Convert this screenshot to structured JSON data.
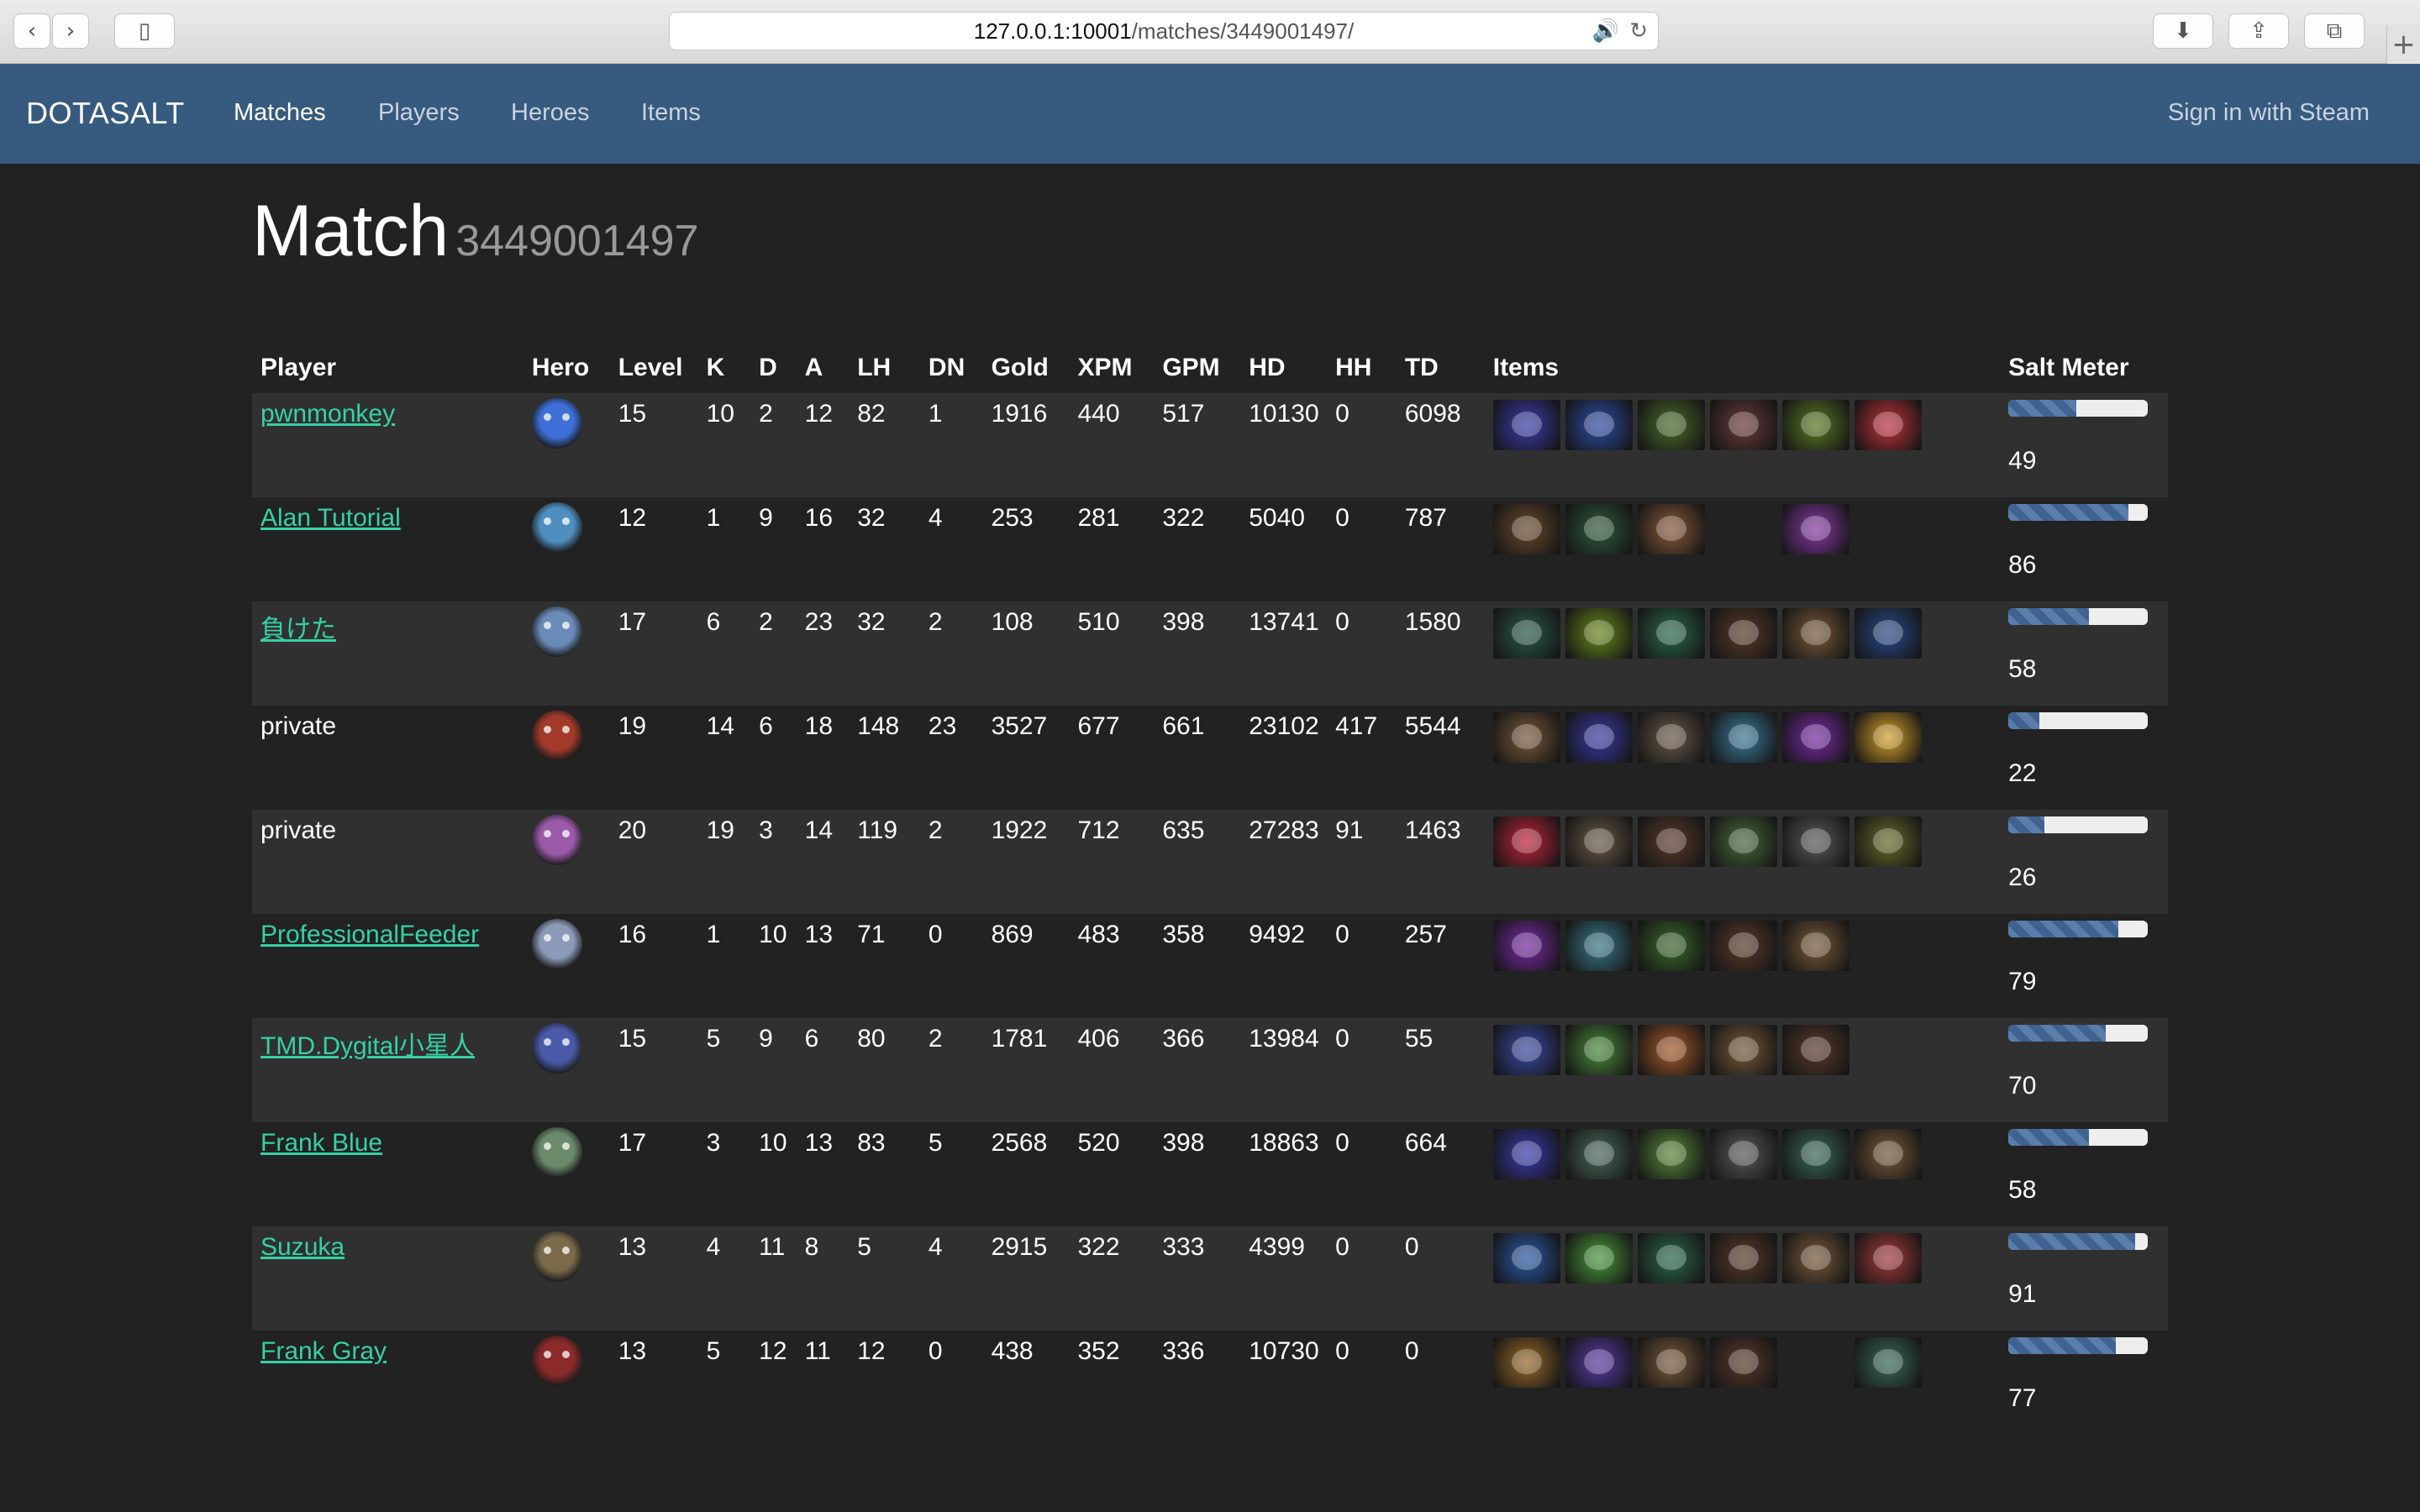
{
  "browser": {
    "url_host": "127.0.0.1:10001",
    "url_path": "/matches/3449001497/"
  },
  "nav": {
    "brand": "DOTASALT",
    "links": [
      "Matches",
      "Players",
      "Heroes",
      "Items"
    ],
    "signin": "Sign in with Steam"
  },
  "page": {
    "title": "Match",
    "match_id": "3449001497"
  },
  "table": {
    "headers": [
      "Player",
      "Hero",
      "Level",
      "K",
      "D",
      "A",
      "LH",
      "DN",
      "Gold",
      "XPM",
      "GPM",
      "HD",
      "HH",
      "TD",
      "Items",
      "Salt Meter"
    ],
    "rows": [
      {
        "player": "pwnmonkey",
        "link": true,
        "hero_color": "#3d6fd6",
        "level": "15",
        "k": "10",
        "d": "2",
        "a": "12",
        "lh": "82",
        "dn": "1",
        "gold": "1916",
        "xpm": "440",
        "gpm": "517",
        "hd": "10130",
        "hh": "0",
        "td": "6098",
        "items": [
          "#3c3cb0",
          "#2d4ea8",
          "#4a6b2a",
          "#6b3a3a",
          "#5a7a24",
          "#c2333c"
        ],
        "salt": "49",
        "salt_fraction": 0.49
      },
      {
        "player": "Alan Tutorial",
        "link": true,
        "hero_color": "#4f8fc0",
        "level": "12",
        "k": "1",
        "d": "9",
        "a": "16",
        "lh": "32",
        "dn": "4",
        "gold": "253",
        "xpm": "281",
        "gpm": "322",
        "hd": "5040",
        "hh": "0",
        "td": "787",
        "items": [
          "#6a4a2c",
          "#2e5c3c",
          "#8a5a3a",
          "",
          "#8a3aa8",
          ""
        ],
        "salt": "86",
        "salt_fraction": 0.86
      },
      {
        "player": "負けた",
        "link": true,
        "hero_color": "#6a8ab8",
        "level": "17",
        "k": "6",
        "d": "2",
        "a": "23",
        "lh": "32",
        "dn": "2",
        "gold": "108",
        "xpm": "510",
        "gpm": "398",
        "hd": "13741",
        "hh": "0",
        "td": "1580",
        "items": [
          "#2a5a4a",
          "#6a8a1a",
          "#2a6a4a",
          "#5a3a2a",
          "#7a5a3a",
          "#2a4a8a"
        ],
        "salt": "58",
        "salt_fraction": 0.58
      },
      {
        "player": "private",
        "link": false,
        "hero_color": "#a23a2a",
        "level": "19",
        "k": "14",
        "d": "6",
        "a": "18",
        "lh": "148",
        "dn": "23",
        "gold": "3527",
        "xpm": "677",
        "gpm": "661",
        "hd": "23102",
        "hh": "417",
        "td": "5544",
        "items": [
          "#7a5a3a",
          "#3a3aa8",
          "#6a5a4a",
          "#3a7a9a",
          "#7a2aa8",
          "#d8a02a"
        ],
        "salt": "22",
        "salt_fraction": 0.22
      },
      {
        "player": "private",
        "link": false,
        "hero_color": "#9a5aa8",
        "level": "20",
        "k": "19",
        "d": "3",
        "a": "14",
        "lh": "119",
        "dn": "2",
        "gold": "1922",
        "xpm": "712",
        "gpm": "635",
        "hd": "27283",
        "hh": "91",
        "td": "1463",
        "items": [
          "#c2233a",
          "#6a5a4a",
          "#5a3a2a",
          "#4a6a3a",
          "#5a5a5a",
          "#6a6a2a"
        ],
        "salt": "26",
        "salt_fraction": 0.26
      },
      {
        "player": "ProfessionalFeeder",
        "link": true,
        "hero_color": "#8a9ab8",
        "level": "16",
        "k": "1",
        "d": "10",
        "a": "13",
        "lh": "71",
        "dn": "0",
        "gold": "869",
        "xpm": "483",
        "gpm": "358",
        "hd": "9492",
        "hh": "0",
        "td": "257",
        "items": [
          "#7a2aa8",
          "#3a7a8a",
          "#3a6a2a",
          "#5a3a2a",
          "#7a5a3a",
          ""
        ],
        "salt": "79",
        "salt_fraction": 0.79
      },
      {
        "player": "TMD.Dygital小星人",
        "link": true,
        "hero_color": "#4a5aa8",
        "level": "15",
        "k": "5",
        "d": "9",
        "a": "6",
        "lh": "80",
        "dn": "2",
        "gold": "1781",
        "xpm": "406",
        "gpm": "366",
        "hd": "13984",
        "hh": "0",
        "td": "55",
        "items": [
          "#3a4aa8",
          "#4a8a3a",
          "#a85a2a",
          "#7a5a3a",
          "#5a3a2a",
          ""
        ],
        "salt": "70",
        "salt_fraction": 0.7
      },
      {
        "player": "Frank Blue",
        "link": true,
        "hero_color": "#6a8a6a",
        "level": "17",
        "k": "3",
        "d": "10",
        "a": "13",
        "lh": "83",
        "dn": "5",
        "gold": "2568",
        "xpm": "520",
        "gpm": "398",
        "hd": "18863",
        "hh": "0",
        "td": "664",
        "items": [
          "#3a3ab0",
          "#4a6a5a",
          "#5a8a3a",
          "#5a5a5a",
          "#3a6a5a",
          "#7a5a3a"
        ],
        "salt": "58",
        "salt_fraction": 0.58
      },
      {
        "player": "Suzuka",
        "link": true,
        "hero_color": "#7a6a4a",
        "level": "13",
        "k": "4",
        "d": "11",
        "a": "8",
        "lh": "5",
        "dn": "4",
        "gold": "2915",
        "xpm": "322",
        "gpm": "333",
        "hd": "4399",
        "hh": "0",
        "td": "0",
        "items": [
          "#2a5aa8",
          "#4a9a3a",
          "#2a6a4a",
          "#5a3a2a",
          "#7a5a3a",
          "#a83a3a"
        ],
        "salt": "91",
        "salt_fraction": 0.91
      },
      {
        "player": "Frank Gray",
        "link": true,
        "hero_color": "#8a2a2a",
        "level": "13",
        "k": "5",
        "d": "12",
        "a": "11",
        "lh": "12",
        "dn": "0",
        "gold": "438",
        "xpm": "352",
        "gpm": "336",
        "hd": "10730",
        "hh": "0",
        "td": "0",
        "items": [
          "#9a6a2a",
          "#5a3aa8",
          "#7a5a3a",
          "#5a3a2a",
          "",
          "#3a6a5a"
        ],
        "salt": "77",
        "salt_fraction": 0.77
      }
    ]
  }
}
